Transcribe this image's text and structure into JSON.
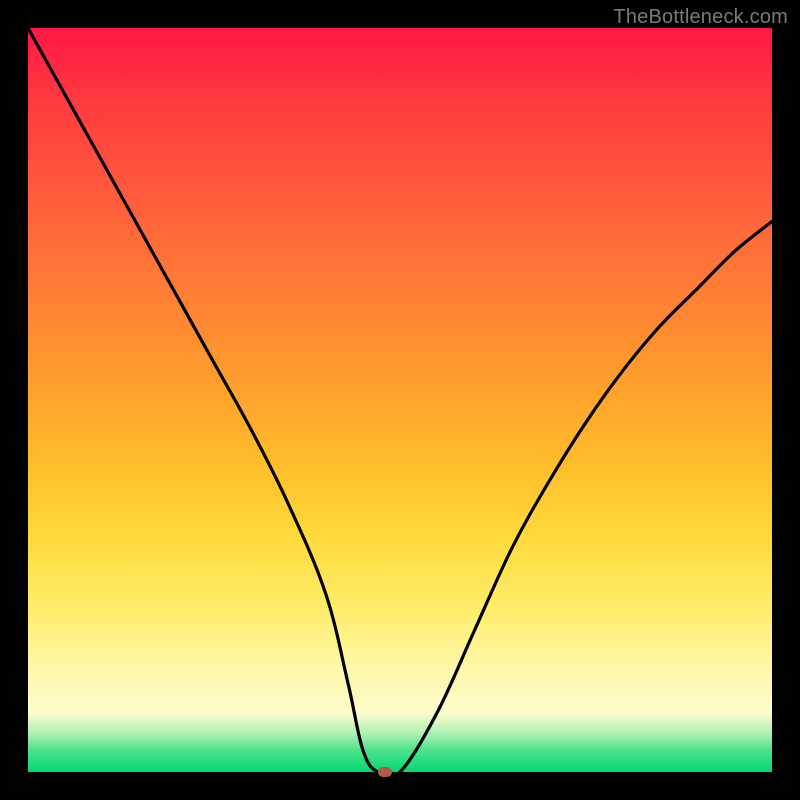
{
  "watermark": "TheBottleneck.com",
  "chart_data": {
    "type": "line",
    "title": "",
    "xlabel": "",
    "ylabel": "",
    "xlim": [
      0,
      100
    ],
    "ylim": [
      0,
      100
    ],
    "gradient_stops": [
      {
        "pos": 0,
        "color": "#ff1744"
      },
      {
        "pos": 10,
        "color": "#ff3b3f"
      },
      {
        "pos": 22,
        "color": "#ff5a3c"
      },
      {
        "pos": 34,
        "color": "#ff7a36"
      },
      {
        "pos": 46,
        "color": "#ff9a2e"
      },
      {
        "pos": 58,
        "color": "#ffbb2a"
      },
      {
        "pos": 68,
        "color": "#ffd93a"
      },
      {
        "pos": 78,
        "color": "#ffed6a"
      },
      {
        "pos": 86,
        "color": "#fff7a8"
      },
      {
        "pos": 92,
        "color": "#fffccd"
      },
      {
        "pos": 95,
        "color": "#a8f0b0"
      },
      {
        "pos": 97,
        "color": "#4fe38a"
      },
      {
        "pos": 100,
        "color": "#00d872"
      }
    ],
    "series": [
      {
        "name": "bottleneck-curve",
        "x": [
          0,
          5,
          10,
          15,
          20,
          25,
          30,
          35,
          40,
          43,
          45,
          47,
          50,
          55,
          60,
          65,
          70,
          75,
          80,
          85,
          90,
          95,
          100
        ],
        "y": [
          100,
          91,
          82,
          73,
          64,
          55,
          46,
          36,
          24,
          12,
          3,
          0,
          0,
          8,
          19,
          30,
          39,
          47,
          54,
          60,
          65,
          70,
          74
        ]
      }
    ],
    "marker": {
      "x": 48,
      "y": 0,
      "color": "#b15a4a"
    }
  }
}
